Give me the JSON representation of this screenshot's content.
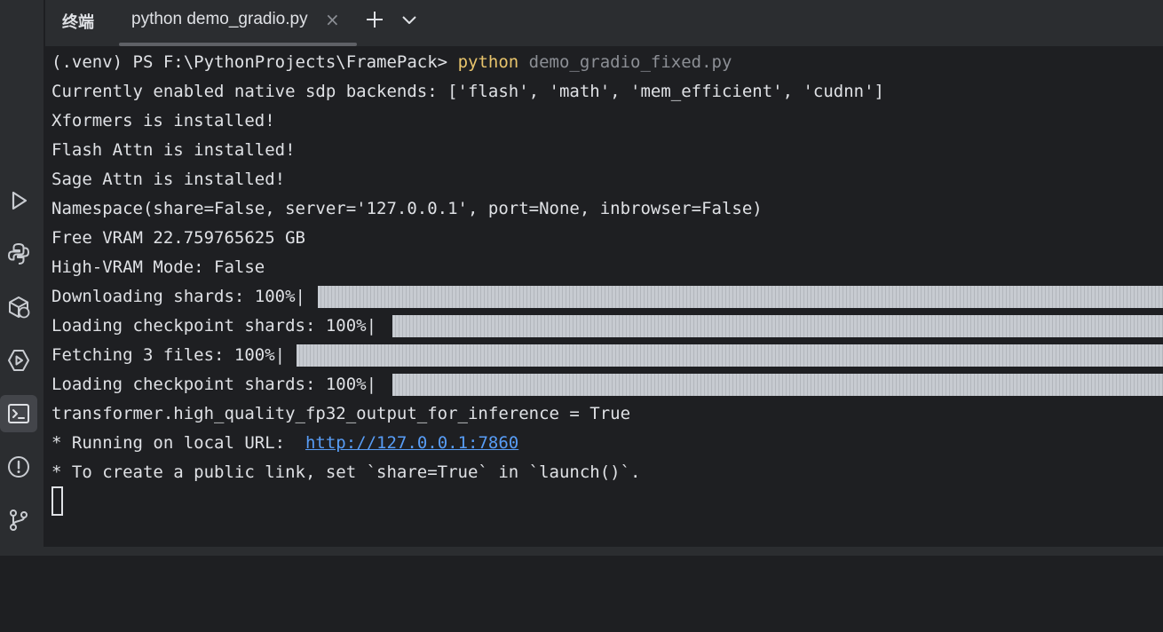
{
  "toolbar": {
    "items": [
      {
        "name": "run-icon",
        "active": false
      },
      {
        "name": "python-console-icon",
        "active": false
      },
      {
        "name": "python-packages-icon",
        "active": false
      },
      {
        "name": "services-icon",
        "active": false
      },
      {
        "name": "terminal-icon",
        "active": true
      },
      {
        "name": "problems-icon",
        "active": false
      },
      {
        "name": "git-icon",
        "active": false
      }
    ]
  },
  "tabbar": {
    "panel_title": "终端",
    "tab_label": "python demo_gradio.py",
    "close_glyph": "×"
  },
  "terminal": {
    "prompt": "(.venv) PS F:\\PythonProjects\\FramePack> ",
    "command": "python",
    "command_args": " demo_gradio_fixed.py",
    "lines": [
      "Currently enabled native sdp backends: ['flash', 'math', 'mem_efficient', 'cudnn']",
      "Xformers is installed!",
      "Flash Attn is installed!",
      "Sage Attn is installed!",
      "Namespace(share=False, server='127.0.0.1', port=None, inbrowser=False)",
      "Free VRAM 22.759765625 GB",
      "High-VRAM Mode: False"
    ],
    "progress": [
      {
        "label": "Downloading shards: 100%|",
        "percent": 100
      },
      {
        "label": "Loading checkpoint shards: 100%|",
        "percent": 100
      },
      {
        "label": "Fetching 3 files: 100%|",
        "percent": 100
      },
      {
        "label": "Loading checkpoint shards: 100%|",
        "percent": 100
      }
    ],
    "after_lines": [
      "transformer.high_quality_fp32_output_for_inference = True"
    ],
    "running_prefix": "* Running on local URL:  ",
    "running_url": "http://127.0.0.1:7860",
    "public_link_line": "* To create a public link, set `share=True` in `launch()`."
  },
  "colors": {
    "background": "#1e1f22",
    "toolbar": "#2b2d30",
    "text": "#dfe1e5",
    "command": "#e8c46c",
    "muted": "#8c8f95",
    "link": "#589df6",
    "progress": "#c7cbd1"
  }
}
